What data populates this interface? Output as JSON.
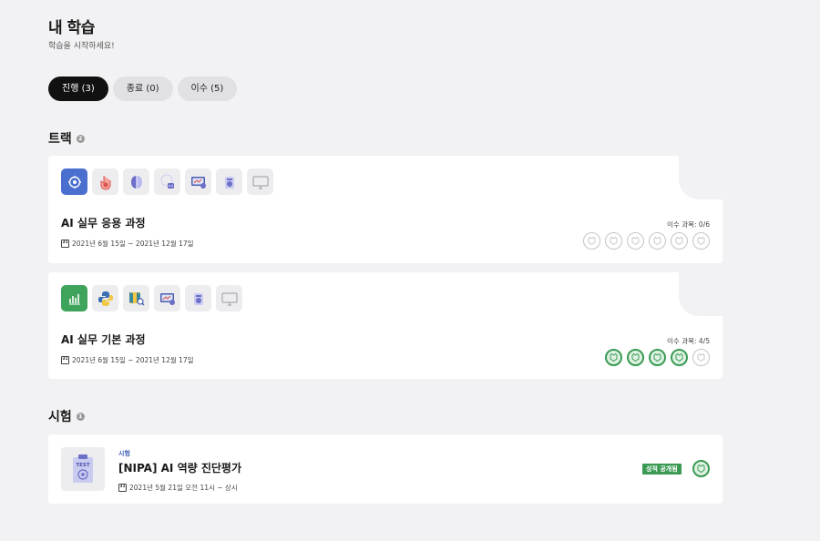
{
  "header": {
    "title": "내 학습",
    "subtitle": "학습을 시작하세요!"
  },
  "tabs": [
    {
      "label": "진행 (3)",
      "active": true
    },
    {
      "label": "종료 (0)",
      "active": false
    },
    {
      "label": "이수 (5)",
      "active": false
    }
  ],
  "tracks": {
    "title": "트랙",
    "count": "2",
    "items": [
      {
        "title": "AI 실무 응용 과정",
        "date_range": "2021년 6월 15일 ~ 2021년 12월 17일",
        "progress_label": "이수 과목: 0/6",
        "completed": 0,
        "total": 6,
        "icons": [
          "brain-chip-icon",
          "hand-robot-icon",
          "brain-icon",
          "neural-robot-icon",
          "monitor-chart-icon",
          "robot-icon",
          "monitor-icon"
        ]
      },
      {
        "title": "AI 실무 기본 과정",
        "date_range": "2021년 6월 15일 ~ 2021년 12월 17일",
        "progress_label": "이수 과목: 4/5",
        "completed": 4,
        "total": 5,
        "icons": [
          "bar-chart-icon",
          "python-icon",
          "map-search-icon",
          "monitor-chart-icon",
          "robot-icon",
          "monitor-icon"
        ]
      }
    ]
  },
  "exams": {
    "title": "시험",
    "count": "1",
    "items": [
      {
        "kind": "시험",
        "title": "[NIPA] AI 역량 진단평가",
        "date": "2021년 5월 21일 오전 11시 ~ 상시",
        "status": "성적 공개됨",
        "thumb_text": "TEST"
      }
    ]
  },
  "colors": {
    "accent_green": "#3a9a53",
    "accent_blue": "#4a6fcf",
    "tab_active_bg": "#111111",
    "page_bg": "#f2f2f4"
  }
}
